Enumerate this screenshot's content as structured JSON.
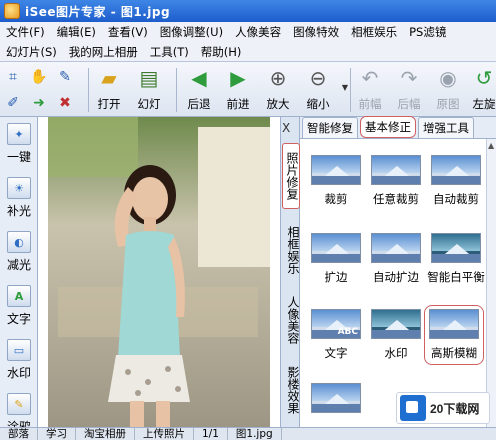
{
  "window": {
    "title": "iSee图片专家 - 图1.jpg"
  },
  "menu": {
    "row1": [
      "文件(F)",
      "编辑(E)",
      "查看(V)",
      "图像调整(U)",
      "人像美容",
      "图像特效",
      "相框娱乐",
      "PS滤镜"
    ],
    "row2": [
      "幻灯片(S)",
      "我的网上相册",
      "工具(T)",
      "帮助(H)"
    ]
  },
  "toolbar": {
    "open": "打开",
    "slideshow": "幻灯",
    "back": "后退",
    "forward": "前进",
    "zoom_in": "放大",
    "zoom_out": "缩小",
    "prev": "前幅",
    "next": "后幅",
    "original": "原图",
    "rotate_left": "左旋"
  },
  "left_panel": [
    "一键",
    "补光",
    "减光",
    "文字",
    "水印",
    "涂鸦"
  ],
  "vertical_tabs": [
    "照片修复",
    "相框娱乐",
    "人像美容",
    "影楼效果"
  ],
  "right_panel": {
    "tabs": [
      "智能修复",
      "基本修正",
      "增强工具"
    ],
    "active_tab": "基本修正",
    "tools": [
      "裁剪",
      "任意裁剪",
      "自动裁剪",
      "扩边",
      "自动扩边",
      "智能白平衡",
      "文字",
      "水印",
      "高斯模糊"
    ],
    "selected_tool": "高斯模糊",
    "thumb_overlay_text": "ABC"
  },
  "status_bar": [
    "部落",
    "学习",
    "淘宝相册",
    "上传照片",
    "1/1",
    "图1.jpg"
  ],
  "watermark": {
    "text": "20下载网"
  },
  "icons": [
    "app-icon",
    "folder-open-icon",
    "slideshow-icon",
    "arrow-left-icon",
    "arrow-right-icon",
    "zoom-in-icon",
    "zoom-out-icon",
    "undo-icon",
    "redo-icon",
    "original-size-icon",
    "rotate-left-icon"
  ],
  "colors": {
    "titlebar": "#1d5dcc",
    "accent_red": "#d06060",
    "toolbar_bg": "#dde5f1"
  }
}
